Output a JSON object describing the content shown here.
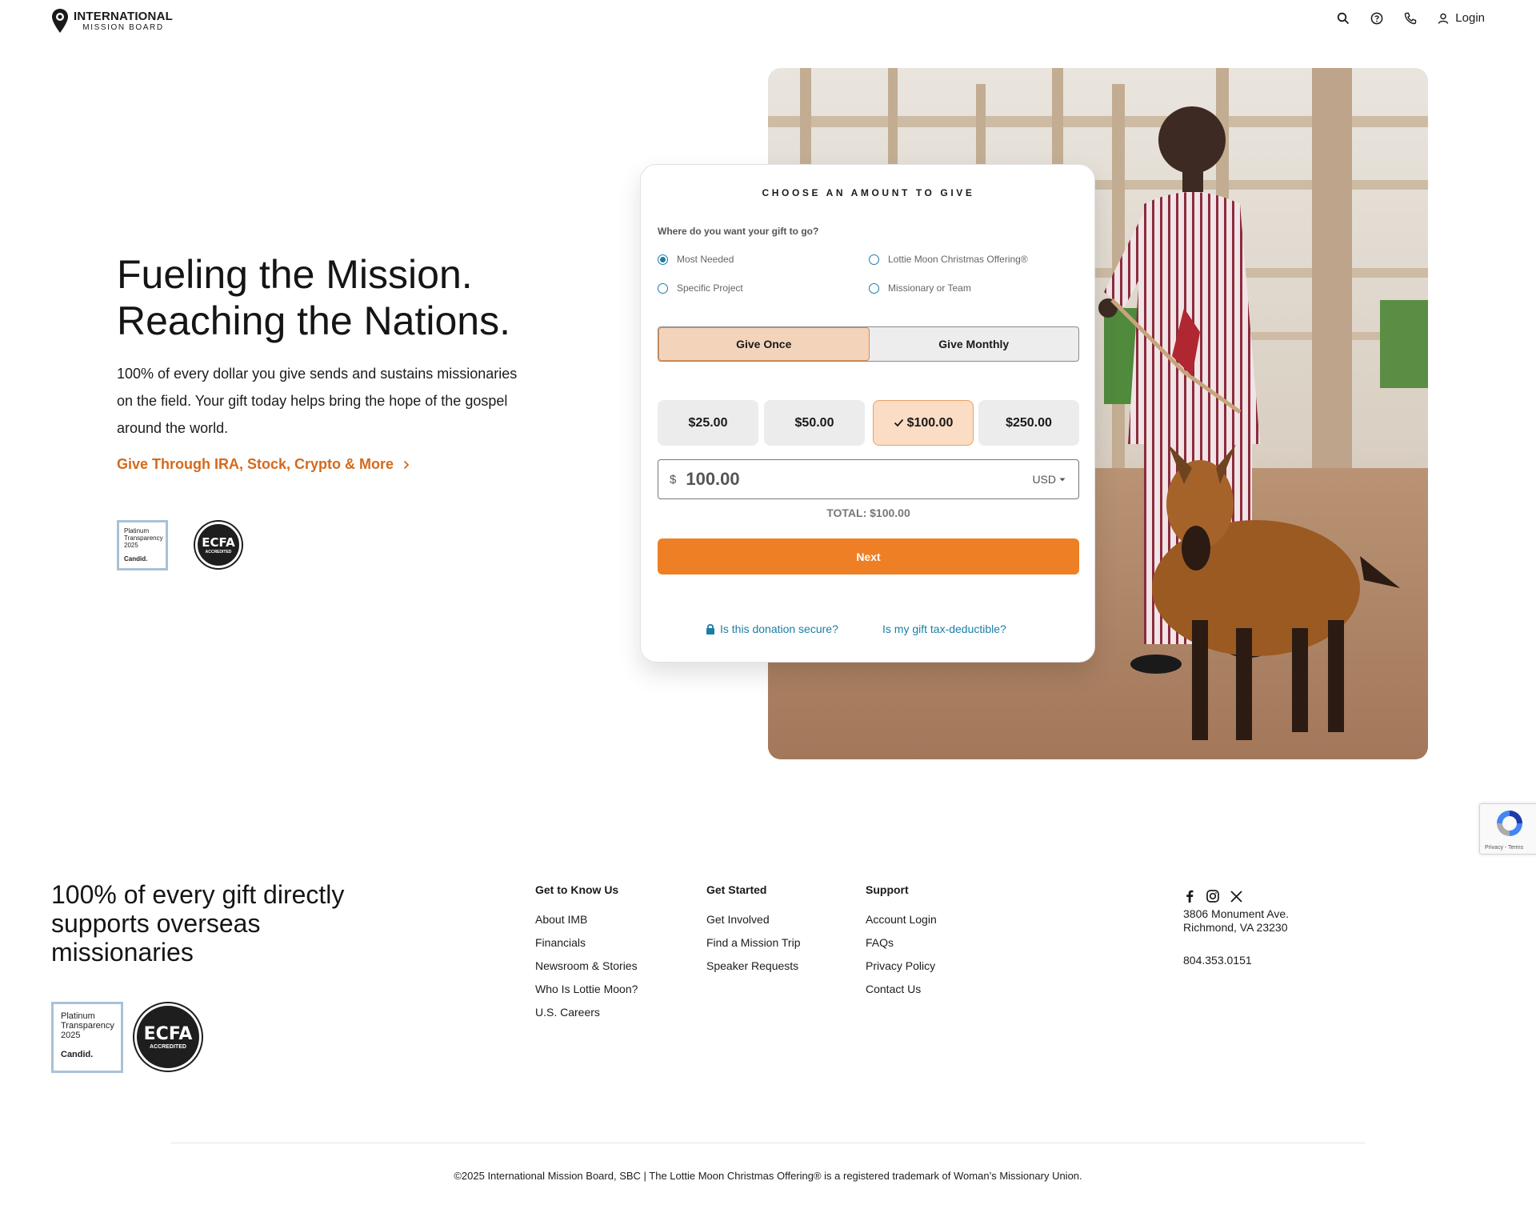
{
  "header": {
    "logo_line1": "INTERNATIONAL",
    "logo_line2": "MISSION BOARD",
    "login_label": "Login",
    "icons": [
      "search-icon",
      "help-icon",
      "phone-icon",
      "user-icon"
    ]
  },
  "hero": {
    "title_line1": "Fueling the Mission.",
    "title_line2": "Reaching the Nations.",
    "body_line1": "100% of every dollar you give sends and sustains missionaries",
    "body_line2": "on the field. Your gift today helps bring the hope of the gospel",
    "body_line3": "around the world.",
    "link_label": "Give Through IRA, Stock, Crypto & More",
    "accent_color": "#d46a1c"
  },
  "badges": {
    "candid_line1": "Platinum",
    "candid_line2": "Transparency",
    "candid_year": "2025",
    "candid_brand": "Candid.",
    "ecfa_label": "ECFA",
    "ecfa_sub": "ACCREDITED"
  },
  "form": {
    "title": "CHOOSE AN AMOUNT TO GIVE",
    "question": "Where do you want your gift to go?",
    "destinations": [
      {
        "label": "Most Needed",
        "selected": true
      },
      {
        "label": "Lottie Moon Christmas Offering®",
        "selected": false
      },
      {
        "label": "Specific Project",
        "selected": false
      },
      {
        "label": "Missionary or Team",
        "selected": false
      }
    ],
    "frequency": {
      "once": "Give Once",
      "monthly": "Give Monthly",
      "selected": "once"
    },
    "amounts": [
      {
        "label": "$25.00",
        "selected": false
      },
      {
        "label": "$50.00",
        "selected": false
      },
      {
        "label": "$100.00",
        "selected": true
      },
      {
        "label": "$250.00",
        "selected": false
      }
    ],
    "currency_symbol": "$",
    "amount_value": "100.00",
    "currency": "USD",
    "total": "TOTAL: $100.00",
    "next_label": "Next",
    "secure_link": "Is this donation secure?",
    "tax_link": "Is my gift tax-deductible?",
    "button_color": "#ee7f24",
    "link_color": "#1b7ea6"
  },
  "recaptcha": {
    "terms": "Privacy - Terms"
  },
  "footer": {
    "headline_line1": "100% of every gift directly",
    "headline_line2": "supports overseas",
    "headline_line3": "missionaries",
    "columns": [
      {
        "title": "Get to Know Us",
        "items": [
          "About IMB",
          "Financials",
          "Newsroom & Stories",
          "Who Is Lottie Moon?",
          "U.S. Careers"
        ]
      },
      {
        "title": "Get Started",
        "items": [
          "Get Involved",
          "Find a Mission Trip",
          "Speaker Requests"
        ]
      },
      {
        "title": "Support",
        "items": [
          "Account Login",
          "FAQs",
          "Privacy Policy",
          "Contact Us"
        ]
      }
    ],
    "social": [
      "facebook-icon",
      "instagram-icon",
      "x-icon"
    ],
    "address_line1": "3806 Monument Ave.",
    "address_line2": "Richmond, VA 23230",
    "phone": "804.353.0151",
    "copyright": "©2025 International Mission Board, SBC | The Lottie Moon Christmas Offering® is a registered trademark of Woman’s Missionary Union."
  }
}
